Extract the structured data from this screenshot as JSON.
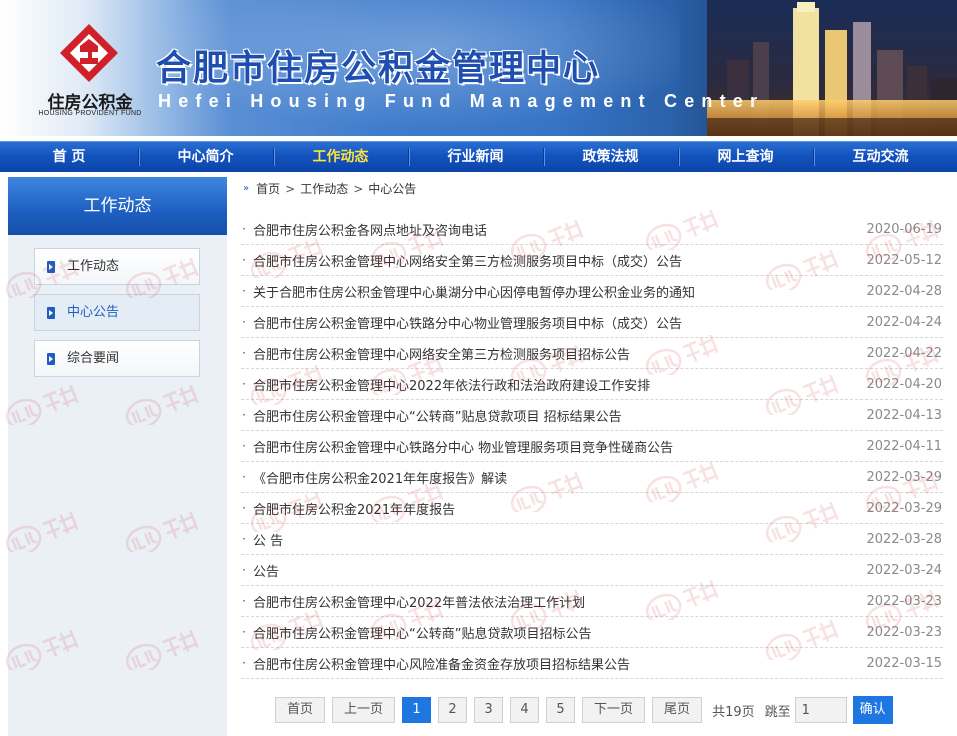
{
  "header": {
    "logo_cn": "住房公积金",
    "logo_en": "HOUSING PROVIDENT FUND",
    "title": "合肥市住房公积金管理中心",
    "subtitle": "Hefei Housing Fund Management Center",
    "colors": {
      "title": "#1e4fb0",
      "logo_mark": "#d0202a"
    }
  },
  "nav": {
    "items": [
      "首 页",
      "中心简介",
      "工作动态",
      "行业新闻",
      "政策法规",
      "网上查询",
      "互动交流"
    ],
    "active_index": 2,
    "colors": {
      "background": "#1353bf",
      "active_text": "#ffe23c"
    }
  },
  "sidebar": {
    "title": "工作动态",
    "items": [
      "工作动态",
      "中心公告",
      "综合要闻"
    ],
    "active_index": 1
  },
  "breadcrumb": {
    "icon": "double-chevron-right-icon",
    "items": [
      "首页",
      "工作动态",
      "中心公告"
    ],
    "separator": ">"
  },
  "news": [
    {
      "title": "合肥市住房公积金各网点地址及咨询电话",
      "date": "2020-06-19"
    },
    {
      "title": "合肥市住房公积金管理中心网络安全第三方检测服务项目中标（成交）公告",
      "date": "2022-05-12"
    },
    {
      "title": "关于合肥市住房公积金管理中心巢湖分中心因停电暂停办理公积金业务的通知",
      "date": "2022-04-28"
    },
    {
      "title": "合肥市住房公积金管理中心铁路分中心物业管理服务项目中标（成交）公告",
      "date": "2022-04-24"
    },
    {
      "title": "合肥市住房公积金管理中心网络安全第三方检测服务项目招标公告",
      "date": "2022-04-22"
    },
    {
      "title": "合肥市住房公积金管理中心2022年依法行政和法治政府建设工作安排",
      "date": "2022-04-20"
    },
    {
      "title": "合肥市住房公积金管理中心“公转商”贴息贷款项目 招标结果公告",
      "date": "2022-04-13"
    },
    {
      "title": "合肥市住房公积金管理中心铁路分中心 物业管理服务项目竞争性磋商公告",
      "date": "2022-04-11"
    },
    {
      "title": "《合肥市住房公积金2021年年度报告》解读",
      "date": "2022-03-29"
    },
    {
      "title": "合肥市住房公积金2021年年度报告",
      "date": "2022-03-29"
    },
    {
      "title": "公 告",
      "date": "2022-03-28"
    },
    {
      "title": "公告",
      "date": "2022-03-24"
    },
    {
      "title": "合肥市住房公积金管理中心2022年普法依法治理工作计划",
      "date": "2022-03-23"
    },
    {
      "title": "合肥市住房公积金管理中心“公转商”贴息贷款项目招标公告",
      "date": "2022-03-23"
    },
    {
      "title": "合肥市住房公积金管理中心风险准备金资金存放项目招标结果公告",
      "date": "2022-03-15"
    }
  ],
  "pager": {
    "first": "首页",
    "prev": "上一页",
    "pages": [
      "1",
      "2",
      "3",
      "4",
      "5"
    ],
    "current": "1",
    "next": "下一页",
    "last": "尾页",
    "total": "共19页",
    "jump_label": "跳至",
    "jump_value": "1",
    "confirm": "确认",
    "accent": "#1e77e0"
  },
  "watermark": {
    "text": "乐居",
    "sub": "LEJU"
  }
}
